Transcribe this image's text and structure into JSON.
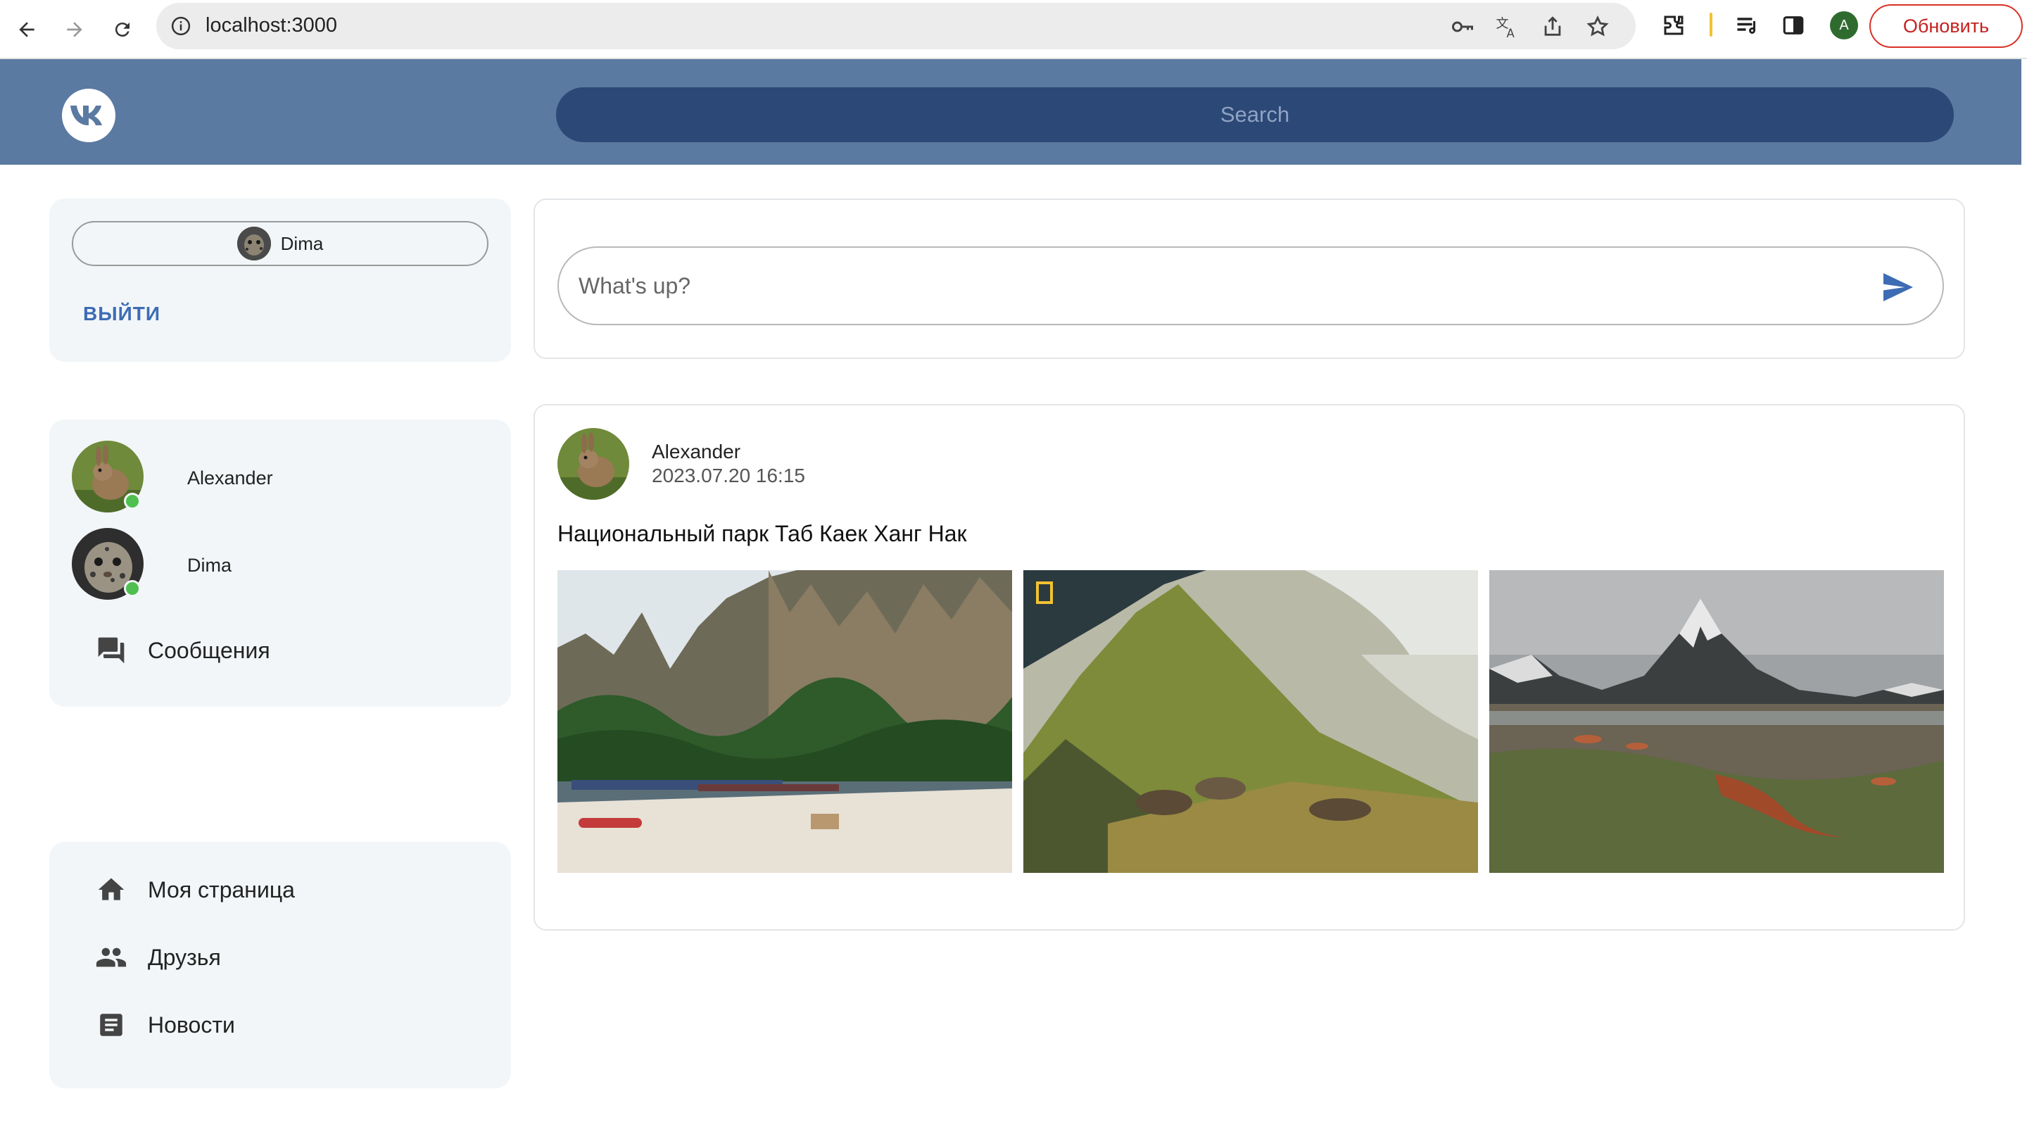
{
  "browser": {
    "url": "localhost:3000",
    "profile_initial": "A",
    "update_label": "Обновить"
  },
  "header": {
    "search_placeholder": "Search"
  },
  "account": {
    "user_name": "Dima",
    "logout_label": "ВЫЙТИ"
  },
  "friends": [
    {
      "name": "Alexander",
      "online": true
    },
    {
      "name": "Dima",
      "online": true
    }
  ],
  "messages_label": "Сообщения",
  "nav": {
    "my_page": "Моя страница",
    "friends": "Друзья",
    "news": "Новости"
  },
  "composer": {
    "placeholder": "What's up?"
  },
  "post": {
    "author": "Alexander",
    "date": "2023.07.20 16:15",
    "text": "Национальный парк Таб Каек Ханг Нак",
    "photos": [
      "beach-cliffs-photo",
      "mountain-ibex-photo",
      "arctic-peak-photo"
    ]
  },
  "colors": {
    "header_bg": "#5b7aa2",
    "search_bg": "#2c4877",
    "panel_bg": "#f2f6f8",
    "accent": "#3d6cb5",
    "online": "#4fbf4f"
  }
}
